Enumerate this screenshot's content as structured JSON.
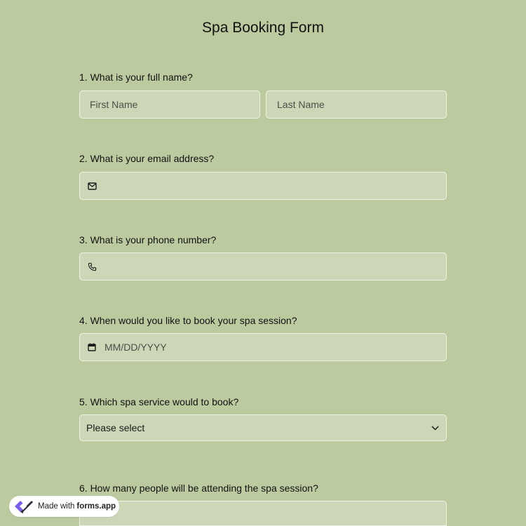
{
  "form": {
    "title": "Spa Booking Form",
    "questions": [
      {
        "label": "1.  What is your full name?",
        "first_name_placeholder": "First Name",
        "last_name_placeholder": "Last Name"
      },
      {
        "label": "2. What is your email address?",
        "icon": "mail-icon"
      },
      {
        "label": "3. What is your phone number?",
        "icon": "phone-icon"
      },
      {
        "label": "4. When would you like to book your spa session?",
        "icon": "calendar-icon",
        "placeholder": "MM/DD/YYYY"
      },
      {
        "label": "5. Which spa service would to book?",
        "selected": "Please select",
        "icon": "chevron-down-icon"
      },
      {
        "label": "6. How many people will be attending the spa session?"
      }
    ]
  },
  "badge": {
    "prefix": "Made with",
    "brand": "forms.app",
    "icon": "forms-app-logo"
  },
  "colors": {
    "background": "#bccaa0",
    "field_background": "#cdd7b8",
    "field_border": "#eef2e4"
  }
}
